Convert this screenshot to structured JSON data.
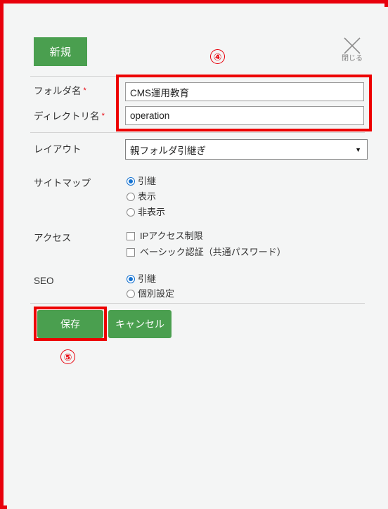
{
  "header": {
    "new_badge_label": "新規",
    "close_label": "閉じる",
    "close_icon": "close-x-icon"
  },
  "annotations": {
    "marker_inputs": "④",
    "marker_save": "⑤"
  },
  "form": {
    "folder_name": {
      "label": "フォルダ名",
      "required_mark": "*",
      "value": "CMS運用教育"
    },
    "directory_name": {
      "label": "ディレクトリ名",
      "required_mark": "*",
      "value": "operation"
    },
    "layout": {
      "label": "レイアウト",
      "selected": "親フォルダ引継ぎ",
      "arrow_icon": "chevron-down-icon",
      "options": [
        "親フォルダ引継ぎ"
      ]
    },
    "sitemap": {
      "label": "サイトマップ",
      "options": [
        {
          "label": "引継",
          "selected": true
        },
        {
          "label": "表示",
          "selected": false
        },
        {
          "label": "非表示",
          "selected": false
        }
      ]
    },
    "access": {
      "label": "アクセス",
      "options": [
        {
          "label": "IPアクセス制限",
          "checked": false
        },
        {
          "label": "ベーシック認証（共通パスワード）",
          "checked": false
        }
      ]
    },
    "seo": {
      "label": "SEO",
      "options": [
        {
          "label": "引継",
          "selected": true
        },
        {
          "label": "個別設定",
          "selected": false
        }
      ]
    }
  },
  "actions": {
    "save_label": "保存",
    "cancel_label": "キャンセル"
  },
  "colors": {
    "green": "#4a9f4f",
    "annotation_red": "#ed0000",
    "radio_blue": "#1673d1",
    "panel_bg": "#f4f5f5"
  }
}
